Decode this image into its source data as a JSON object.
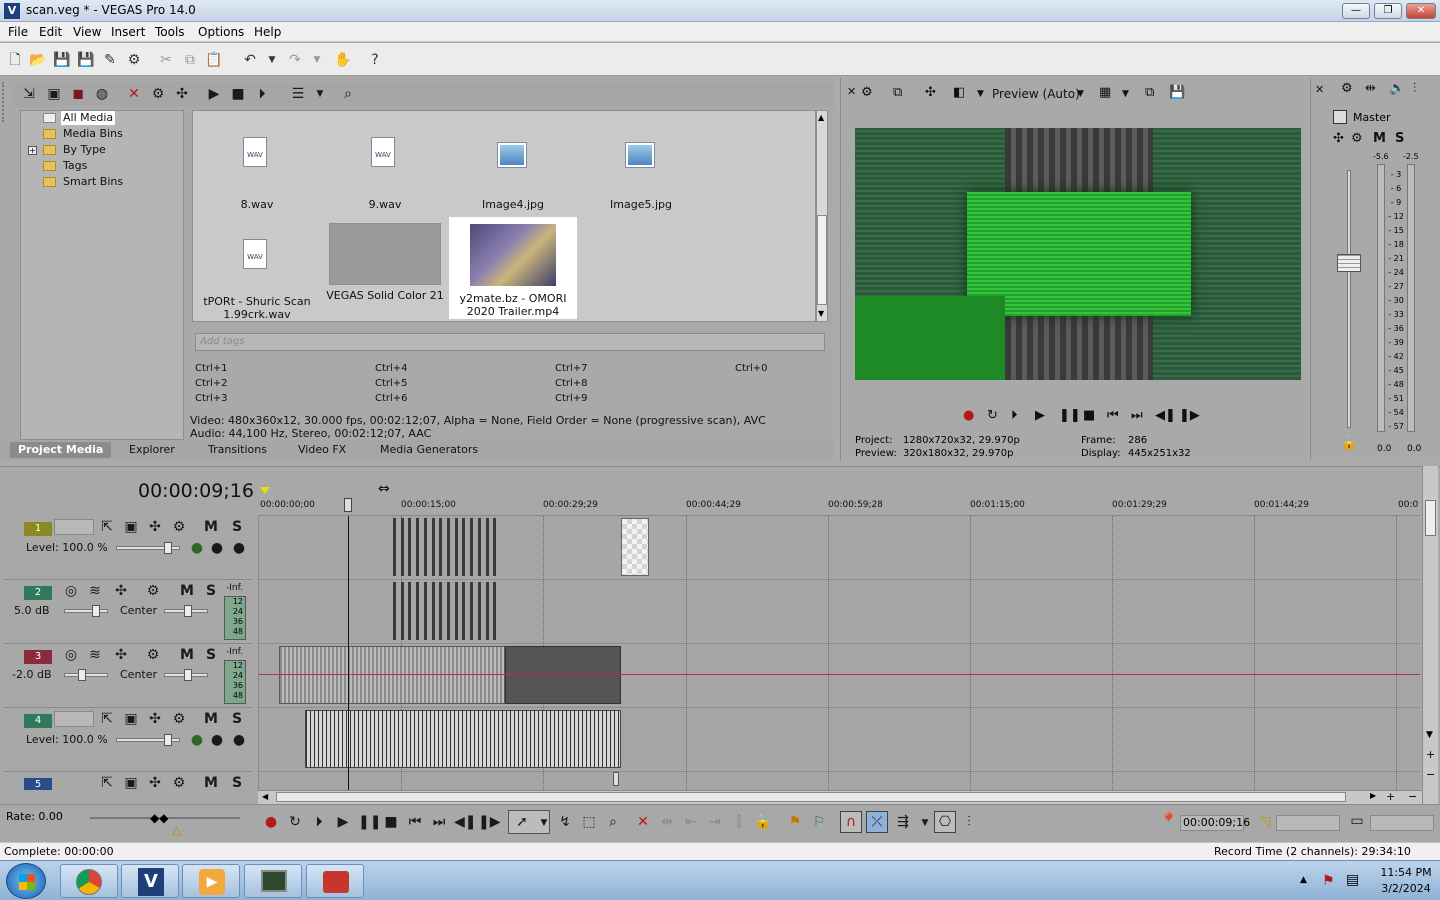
{
  "window": {
    "title": "scan.veg * - VEGAS Pro 14.0",
    "controls": {
      "minimize": "—",
      "maximize": "❐",
      "close": "✕"
    }
  },
  "menu": [
    "File",
    "Edit",
    "View",
    "Insert",
    "Tools",
    "Options",
    "Help"
  ],
  "media_tree": [
    "All Media",
    "Media Bins",
    "By Type",
    "Tags",
    "Smart Bins"
  ],
  "media_items": [
    {
      "name": "8.wav",
      "kind": "wav",
      "icon_text": "WAV"
    },
    {
      "name": "9.wav",
      "kind": "wav",
      "icon_text": "WAV"
    },
    {
      "name": "Image4.jpg",
      "kind": "image"
    },
    {
      "name": "Image5.jpg",
      "kind": "image"
    },
    {
      "name": "tPORt - Shuric Scan 1.99crk.wav",
      "kind": "wav",
      "icon_text": "WAV"
    },
    {
      "name": "VEGAS Solid Color 21",
      "kind": "solid"
    },
    {
      "name": "y2mate.bz - OMORI 2020 Trailer.mp4",
      "kind": "video"
    }
  ],
  "tags_placeholder": "Add tags",
  "shortcuts": [
    "Ctrl+1",
    "Ctrl+2",
    "Ctrl+3",
    "Ctrl+4",
    "Ctrl+5",
    "Ctrl+6",
    "Ctrl+7",
    "Ctrl+8",
    "Ctrl+9",
    "Ctrl+0"
  ],
  "media_info": {
    "video": "Video: 480x360x12, 30.000 fps, 00:02:12;07, Alpha = None, Field Order = None (progressive scan), AVC",
    "audio": "Audio: 44,100 Hz, Stereo, 00:02:12;07, AAC"
  },
  "tabs": [
    "Project Media",
    "Explorer",
    "Transitions",
    "Video FX",
    "Media Generators"
  ],
  "preview": {
    "mode_label": "Preview (Auto)",
    "project_label": "Project:",
    "project_value": "1280x720x32, 29.970p",
    "preview_label": "Preview:",
    "preview_value": "320x180x32, 29.970p",
    "frame_label": "Frame:",
    "frame_value": "286",
    "display_label": "Display:",
    "display_value": "445x251x32"
  },
  "mixer": {
    "title": "Master",
    "m": "M",
    "s": "S",
    "peak_left": "-5.6",
    "peak_right": "-2.5",
    "scale": [
      "3",
      "6",
      "9",
      "12",
      "15",
      "18",
      "21",
      "24",
      "27",
      "30",
      "33",
      "36",
      "39",
      "42",
      "45",
      "48",
      "51",
      "54",
      "57"
    ],
    "bottom_left": "0.0",
    "bottom_right": "0.0"
  },
  "timeline": {
    "timecode": "00:00:09;16",
    "ruler": [
      "00:00:00;00",
      "00:00:15;00",
      "00:00:29;29",
      "00:00:44;29",
      "00:00:59;28",
      "00:01:15;00",
      "00:01:29;29",
      "00:01:44;29",
      "00:0"
    ],
    "tracks": [
      {
        "num": "1",
        "type": "video",
        "color": "#8a8a20",
        "param": "Level: 100.0 %"
      },
      {
        "num": "2",
        "type": "audio",
        "color": "#2f7a5a",
        "param": "5.0 dB",
        "pan": "Center",
        "meter": "-Inf."
      },
      {
        "num": "3",
        "type": "audio",
        "color": "#8a2a3a",
        "param": "-2.0 dB",
        "pan": "Center",
        "meter": "-Inf."
      },
      {
        "num": "4",
        "type": "video",
        "color": "#2f7a5a",
        "param": "Level: 100.0 %"
      },
      {
        "num": "5",
        "type": "video",
        "color": "#2a4a8a",
        "param": ""
      }
    ],
    "meter_scale": [
      "12",
      "24",
      "36",
      "48"
    ],
    "m": "M",
    "s": "S"
  },
  "bottom": {
    "rate": "Rate: 0.00",
    "cursor_time": "00:00:09;16"
  },
  "status": {
    "complete": "Complete: 00:00:00",
    "record_time": "Record Time (2 channels): 29:34:10"
  },
  "taskbar": {
    "time": "11:54 PM",
    "date": "3/2/2024"
  }
}
